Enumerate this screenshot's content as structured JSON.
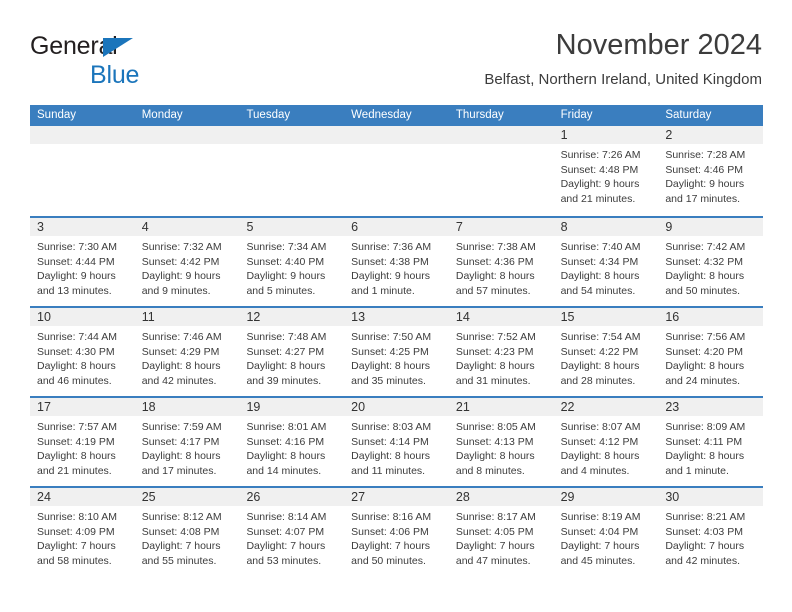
{
  "logo": {
    "line1": "General",
    "line2": "Blue"
  },
  "header": {
    "title": "November 2024",
    "subtitle": "Belfast, Northern Ireland, United Kingdom"
  },
  "colors": {
    "header_blue": "#3a7ebf",
    "logo_blue": "#1b75bb",
    "day_band_gray": "#f0f0f0",
    "text": "#3c3c3c"
  },
  "weekdays": [
    "Sunday",
    "Monday",
    "Tuesday",
    "Wednesday",
    "Thursday",
    "Friday",
    "Saturday"
  ],
  "weeks": [
    [
      {
        "day": "",
        "lines": []
      },
      {
        "day": "",
        "lines": []
      },
      {
        "day": "",
        "lines": []
      },
      {
        "day": "",
        "lines": []
      },
      {
        "day": "",
        "lines": []
      },
      {
        "day": "1",
        "lines": [
          "Sunrise: 7:26 AM",
          "Sunset: 4:48 PM",
          "Daylight: 9 hours",
          "and 21 minutes."
        ]
      },
      {
        "day": "2",
        "lines": [
          "Sunrise: 7:28 AM",
          "Sunset: 4:46 PM",
          "Daylight: 9 hours",
          "and 17 minutes."
        ]
      }
    ],
    [
      {
        "day": "3",
        "lines": [
          "Sunrise: 7:30 AM",
          "Sunset: 4:44 PM",
          "Daylight: 9 hours",
          "and 13 minutes."
        ]
      },
      {
        "day": "4",
        "lines": [
          "Sunrise: 7:32 AM",
          "Sunset: 4:42 PM",
          "Daylight: 9 hours",
          "and 9 minutes."
        ]
      },
      {
        "day": "5",
        "lines": [
          "Sunrise: 7:34 AM",
          "Sunset: 4:40 PM",
          "Daylight: 9 hours",
          "and 5 minutes."
        ]
      },
      {
        "day": "6",
        "lines": [
          "Sunrise: 7:36 AM",
          "Sunset: 4:38 PM",
          "Daylight: 9 hours",
          "and 1 minute."
        ]
      },
      {
        "day": "7",
        "lines": [
          "Sunrise: 7:38 AM",
          "Sunset: 4:36 PM",
          "Daylight: 8 hours",
          "and 57 minutes."
        ]
      },
      {
        "day": "8",
        "lines": [
          "Sunrise: 7:40 AM",
          "Sunset: 4:34 PM",
          "Daylight: 8 hours",
          "and 54 minutes."
        ]
      },
      {
        "day": "9",
        "lines": [
          "Sunrise: 7:42 AM",
          "Sunset: 4:32 PM",
          "Daylight: 8 hours",
          "and 50 minutes."
        ]
      }
    ],
    [
      {
        "day": "10",
        "lines": [
          "Sunrise: 7:44 AM",
          "Sunset: 4:30 PM",
          "Daylight: 8 hours",
          "and 46 minutes."
        ]
      },
      {
        "day": "11",
        "lines": [
          "Sunrise: 7:46 AM",
          "Sunset: 4:29 PM",
          "Daylight: 8 hours",
          "and 42 minutes."
        ]
      },
      {
        "day": "12",
        "lines": [
          "Sunrise: 7:48 AM",
          "Sunset: 4:27 PM",
          "Daylight: 8 hours",
          "and 39 minutes."
        ]
      },
      {
        "day": "13",
        "lines": [
          "Sunrise: 7:50 AM",
          "Sunset: 4:25 PM",
          "Daylight: 8 hours",
          "and 35 minutes."
        ]
      },
      {
        "day": "14",
        "lines": [
          "Sunrise: 7:52 AM",
          "Sunset: 4:23 PM",
          "Daylight: 8 hours",
          "and 31 minutes."
        ]
      },
      {
        "day": "15",
        "lines": [
          "Sunrise: 7:54 AM",
          "Sunset: 4:22 PM",
          "Daylight: 8 hours",
          "and 28 minutes."
        ]
      },
      {
        "day": "16",
        "lines": [
          "Sunrise: 7:56 AM",
          "Sunset: 4:20 PM",
          "Daylight: 8 hours",
          "and 24 minutes."
        ]
      }
    ],
    [
      {
        "day": "17",
        "lines": [
          "Sunrise: 7:57 AM",
          "Sunset: 4:19 PM",
          "Daylight: 8 hours",
          "and 21 minutes."
        ]
      },
      {
        "day": "18",
        "lines": [
          "Sunrise: 7:59 AM",
          "Sunset: 4:17 PM",
          "Daylight: 8 hours",
          "and 17 minutes."
        ]
      },
      {
        "day": "19",
        "lines": [
          "Sunrise: 8:01 AM",
          "Sunset: 4:16 PM",
          "Daylight: 8 hours",
          "and 14 minutes."
        ]
      },
      {
        "day": "20",
        "lines": [
          "Sunrise: 8:03 AM",
          "Sunset: 4:14 PM",
          "Daylight: 8 hours",
          "and 11 minutes."
        ]
      },
      {
        "day": "21",
        "lines": [
          "Sunrise: 8:05 AM",
          "Sunset: 4:13 PM",
          "Daylight: 8 hours",
          "and 8 minutes."
        ]
      },
      {
        "day": "22",
        "lines": [
          "Sunrise: 8:07 AM",
          "Sunset: 4:12 PM",
          "Daylight: 8 hours",
          "and 4 minutes."
        ]
      },
      {
        "day": "23",
        "lines": [
          "Sunrise: 8:09 AM",
          "Sunset: 4:11 PM",
          "Daylight: 8 hours",
          "and 1 minute."
        ]
      }
    ],
    [
      {
        "day": "24",
        "lines": [
          "Sunrise: 8:10 AM",
          "Sunset: 4:09 PM",
          "Daylight: 7 hours",
          "and 58 minutes."
        ]
      },
      {
        "day": "25",
        "lines": [
          "Sunrise: 8:12 AM",
          "Sunset: 4:08 PM",
          "Daylight: 7 hours",
          "and 55 minutes."
        ]
      },
      {
        "day": "26",
        "lines": [
          "Sunrise: 8:14 AM",
          "Sunset: 4:07 PM",
          "Daylight: 7 hours",
          "and 53 minutes."
        ]
      },
      {
        "day": "27",
        "lines": [
          "Sunrise: 8:16 AM",
          "Sunset: 4:06 PM",
          "Daylight: 7 hours",
          "and 50 minutes."
        ]
      },
      {
        "day": "28",
        "lines": [
          "Sunrise: 8:17 AM",
          "Sunset: 4:05 PM",
          "Daylight: 7 hours",
          "and 47 minutes."
        ]
      },
      {
        "day": "29",
        "lines": [
          "Sunrise: 8:19 AM",
          "Sunset: 4:04 PM",
          "Daylight: 7 hours",
          "and 45 minutes."
        ]
      },
      {
        "day": "30",
        "lines": [
          "Sunrise: 8:21 AM",
          "Sunset: 4:03 PM",
          "Daylight: 7 hours",
          "and 42 minutes."
        ]
      }
    ]
  ]
}
